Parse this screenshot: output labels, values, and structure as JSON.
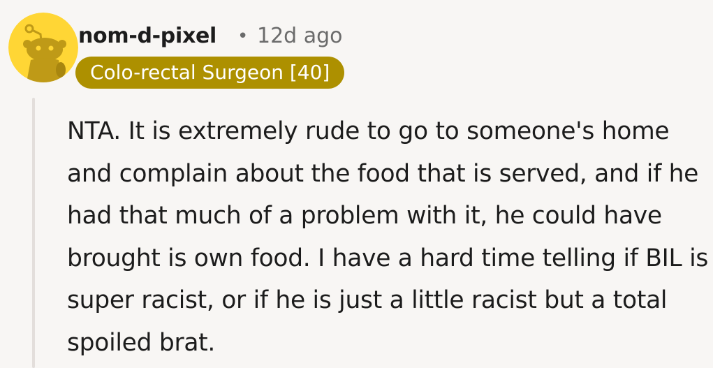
{
  "comment": {
    "username": "nom-d-pixel",
    "separator": "•",
    "timestamp": "12d ago",
    "flair": "Colo-rectal Surgeon [40]",
    "body": "NTA. It is extremely rude to go to someone's home and complain about the food that is served, and if he had that much of a problem with it, he could have brought is own food. I have a hard time telling if BIL is super racist, or if he is just a little racist but a total spoiled brat."
  },
  "colors": {
    "background": "#f8f6f4",
    "flair_background": "#ad9000",
    "avatar_background": "#ffd635",
    "avatar_figure": "#bf9a17"
  },
  "icons": {
    "avatar": "snoo-avatar-icon"
  }
}
